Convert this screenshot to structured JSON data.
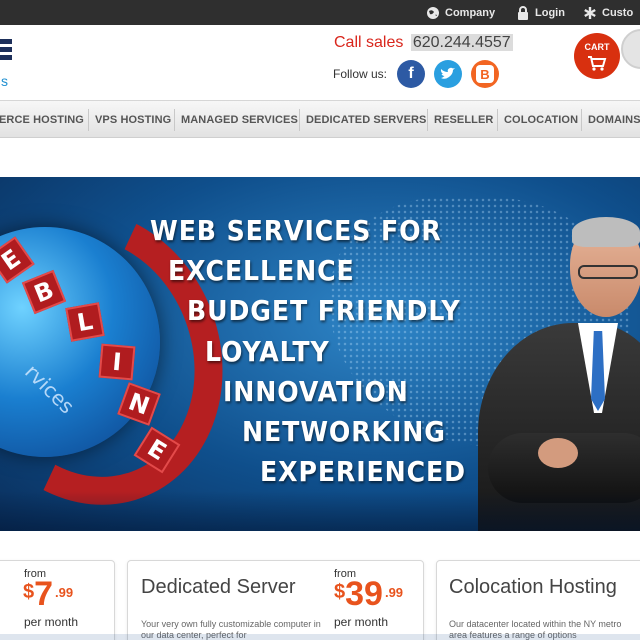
{
  "topbar": {
    "links": [
      {
        "label": "Company",
        "icon": "globe-icon"
      },
      {
        "label": "Login",
        "icon": "lock-icon"
      },
      {
        "label": "Custo",
        "icon": "asterisk-icon"
      }
    ]
  },
  "header": {
    "logo_fragment_text": "s",
    "call_sales_label": "Call sales",
    "phone": "620.244.4557",
    "follow_label": "Follow us:",
    "social": [
      {
        "name": "facebook",
        "glyph": "f",
        "color": "#2d5aa4"
      },
      {
        "name": "twitter",
        "glyph": "t",
        "color": "#2a9fe0"
      },
      {
        "name": "blogger",
        "glyph": "B",
        "color": "#f26522"
      }
    ],
    "cart_label": "CART"
  },
  "nav": {
    "items": [
      "ERCE HOSTING",
      "VPS HOSTING",
      "MANAGED SERVICES",
      "DEDICATED SERVERS",
      "RESELLER",
      "COLOCATION",
      "DOMAINS"
    ]
  },
  "banner": {
    "lines": [
      "WEB SERVICES FOR",
      "EXCELLENCE",
      "BUDGET FRIENDLY",
      "LOYALTY",
      "INNOVATION",
      "NETWORKING",
      "EXPERIENCED"
    ],
    "ring_letters": [
      "E",
      "B",
      "L",
      "I",
      "N",
      "E"
    ],
    "ring_subtext": "rvices"
  },
  "cards": [
    {
      "from": "from",
      "dollar": "$",
      "price": "7",
      "cents": ".99",
      "per": "per month"
    },
    {
      "title": "Dedicated Server",
      "from": "from",
      "dollar": "$",
      "price": "39",
      "cents": ".99",
      "per": "per month",
      "desc": "Your very own fully customizable computer in our data center, perfect for"
    },
    {
      "title": "Colocation Hosting",
      "desc": "Our datacenter located within the NY metro area features a range of options"
    }
  ],
  "colors": {
    "accent_red": "#d9261c",
    "price_orange": "#e8531d",
    "topbar": "#2f2f2f",
    "banner_blue": "#0f4f8c"
  }
}
